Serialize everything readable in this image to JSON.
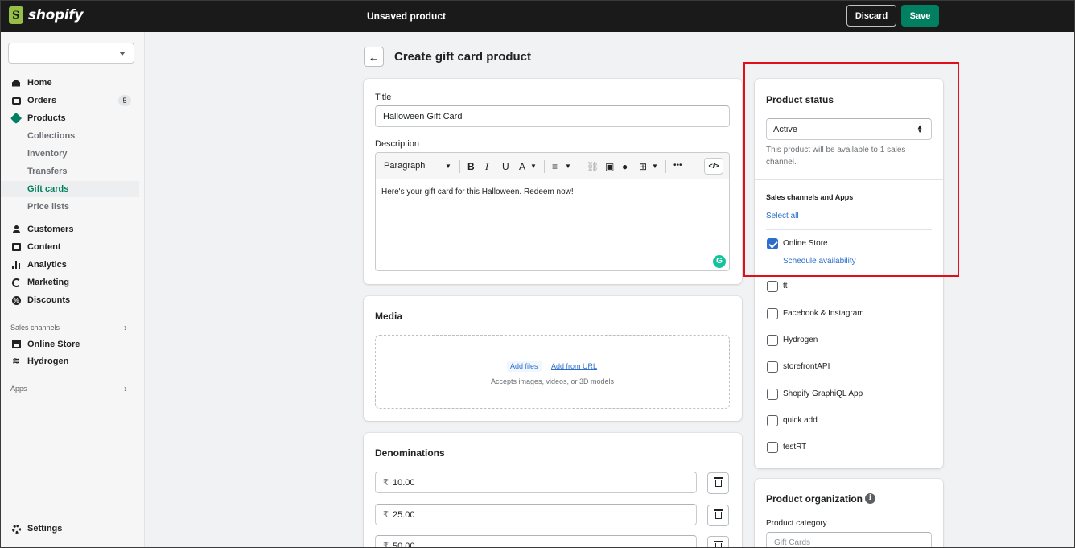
{
  "topbar": {
    "logo_text": "shopify",
    "title": "Unsaved product",
    "discard_label": "Discard",
    "save_label": "Save"
  },
  "sidebar": {
    "store_value": "",
    "items": [
      {
        "label": "Home",
        "icon": "home-icon"
      },
      {
        "label": "Orders",
        "icon": "orders-icon",
        "badge": "5"
      },
      {
        "label": "Products",
        "icon": "tag-icon"
      },
      {
        "label": "Customers",
        "icon": "customers-icon"
      },
      {
        "label": "Content",
        "icon": "content-icon"
      },
      {
        "label": "Analytics",
        "icon": "analytics-icon"
      },
      {
        "label": "Marketing",
        "icon": "marketing-icon"
      },
      {
        "label": "Discounts",
        "icon": "discounts-icon"
      }
    ],
    "product_subitems": [
      "Collections",
      "Inventory",
      "Transfers",
      "Gift cards",
      "Price lists"
    ],
    "active_subitem": "Gift cards",
    "sales_channels_heading": "Sales channels",
    "channels": [
      {
        "label": "Online Store",
        "icon": "store-icon"
      },
      {
        "label": "Hydrogen",
        "icon": "hydrogen-icon"
      }
    ],
    "apps_heading": "Apps",
    "settings_label": "Settings",
    "accent_color": "#008060"
  },
  "page": {
    "back_icon": "arrow-left-icon",
    "title": "Create gift card product"
  },
  "details_card": {
    "title_label": "Title",
    "title_value": "Halloween Gift Card",
    "description_label": "Description",
    "toolbar": {
      "format": "Paragraph",
      "bold": "B",
      "italic": "I",
      "underline": "U",
      "color": "A",
      "align": "≡",
      "more": "•••",
      "code": "</>"
    },
    "body_text": "Here's your gift card for this Halloween. Redeem now!",
    "grammarly": "G"
  },
  "media_card": {
    "heading": "Media",
    "add_files": "Add files",
    "add_from_url": "Add from URL",
    "accepts": "Accepts images, videos, or 3D models"
  },
  "denominations_card": {
    "heading": "Denominations",
    "currency": "₹",
    "values": [
      "10.00",
      "25.00",
      "50.00"
    ]
  },
  "status_card": {
    "heading": "Product status",
    "status_value": "Active",
    "help": "This product will be available to 1 sales channel.",
    "sales_heading": "Sales channels and Apps",
    "select_all": "Select all",
    "channels": [
      {
        "label": "Online Store",
        "checked": true
      },
      {
        "label": "tt",
        "checked": false
      },
      {
        "label": "Facebook & Instagram",
        "checked": false
      },
      {
        "label": "Hydrogen",
        "checked": false
      },
      {
        "label": "storefrontAPI",
        "checked": false
      },
      {
        "label": "Shopify GraphiQL App",
        "checked": false
      },
      {
        "label": "quick add",
        "checked": false
      },
      {
        "label": "testRT",
        "checked": false
      }
    ],
    "schedule": "Schedule availability",
    "highlight_color": "#e0101a"
  },
  "organization_card": {
    "heading": "Product organization",
    "category_label": "Product category",
    "category_placeholder": "Gift Cards"
  }
}
